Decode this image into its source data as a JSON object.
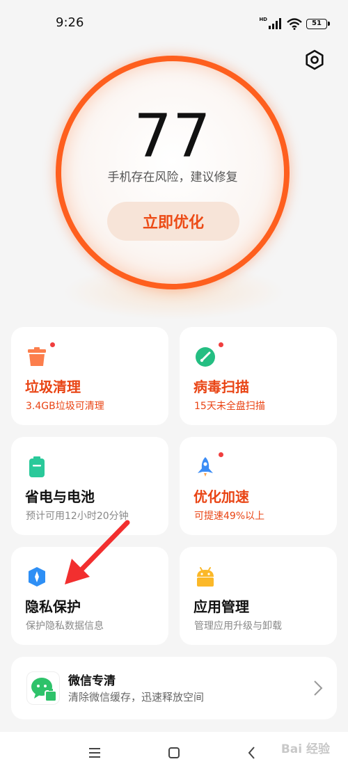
{
  "status_bar": {
    "time": "9:26",
    "network_label": "HD",
    "battery": "51"
  },
  "score": {
    "value": "77",
    "message": "手机存在风险，建议修复",
    "button_label": "立即优化",
    "ring_color": "#fe5f1e"
  },
  "tiles": [
    {
      "title": "垃圾清理",
      "subtitle": "3.4GB垃圾可清理",
      "icon": "trash-icon",
      "alert": true,
      "color": "#fc7e4c"
    },
    {
      "title": "病毒扫描",
      "subtitle": "15天未全盘扫描",
      "icon": "virus-scan-icon",
      "alert": true,
      "color": "#24be82"
    },
    {
      "title": "省电与电池",
      "subtitle": "预计可用12小时20分钟",
      "icon": "battery-icon",
      "alert": false,
      "color": "#2ac99a"
    },
    {
      "title": "优化加速",
      "subtitle": "可提速49%以上",
      "icon": "rocket-icon",
      "alert": true,
      "color": "#3b8cf5"
    },
    {
      "title": "隐私保护",
      "subtitle": "保护隐私数据信息",
      "icon": "privacy-shield-icon",
      "alert": false,
      "color": "#2e8ff5"
    },
    {
      "title": "应用管理",
      "subtitle": "管理应用升级与卸载",
      "icon": "android-icon",
      "alert": false,
      "color": "#fbb828"
    }
  ],
  "wechat": {
    "title": "微信专清",
    "subtitle": "清除微信缓存，迅速释放空间",
    "icon": "wechat-clean-icon"
  },
  "watermark": "Bai 经验",
  "colors": {
    "alert_text": "#e94414",
    "alert_dot": "#f03e3e",
    "annotation_arrow": "#f22f2f"
  }
}
